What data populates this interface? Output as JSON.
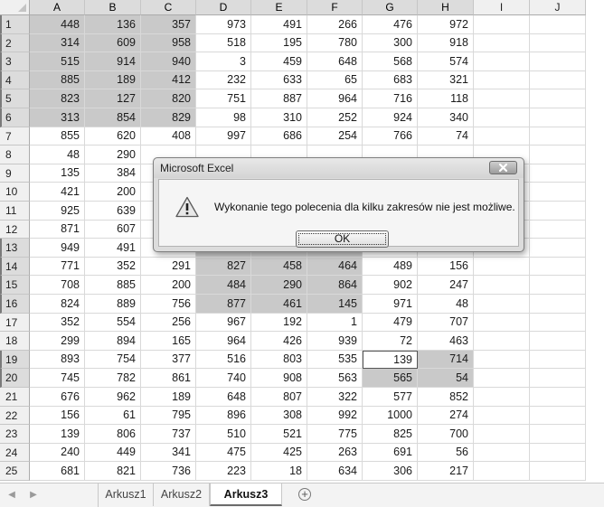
{
  "columns": [
    "A",
    "B",
    "C",
    "D",
    "E",
    "F",
    "G",
    "H",
    "I",
    "J"
  ],
  "rows": [
    {
      "num": "1",
      "cells": [
        "448",
        "136",
        "357",
        "973",
        "491",
        "266",
        "476",
        "972"
      ]
    },
    {
      "num": "2",
      "cells": [
        "314",
        "609",
        "958",
        "518",
        "195",
        "780",
        "300",
        "918"
      ]
    },
    {
      "num": "3",
      "cells": [
        "515",
        "914",
        "940",
        "3",
        "459",
        "648",
        "568",
        "574"
      ]
    },
    {
      "num": "4",
      "cells": [
        "885",
        "189",
        "412",
        "232",
        "633",
        "65",
        "683",
        "321"
      ]
    },
    {
      "num": "5",
      "cells": [
        "823",
        "127",
        "820",
        "751",
        "887",
        "964",
        "716",
        "118"
      ]
    },
    {
      "num": "6",
      "cells": [
        "313",
        "854",
        "829",
        "98",
        "310",
        "252",
        "924",
        "340"
      ]
    },
    {
      "num": "7",
      "cells": [
        "855",
        "620",
        "408",
        "997",
        "686",
        "254",
        "766",
        "74"
      ]
    },
    {
      "num": "8",
      "cells": [
        "48",
        "290",
        "",
        "",
        "",
        "",
        "",
        ""
      ]
    },
    {
      "num": "9",
      "cells": [
        "135",
        "384",
        "",
        "",
        "",
        "",
        "",
        ""
      ]
    },
    {
      "num": "10",
      "cells": [
        "421",
        "200",
        "",
        "",
        "",
        "",
        "",
        ""
      ]
    },
    {
      "num": "11",
      "cells": [
        "925",
        "639",
        "",
        "",
        "",
        "",
        "",
        ""
      ]
    },
    {
      "num": "12",
      "cells": [
        "871",
        "607",
        "",
        "",
        "",
        "",
        "",
        ""
      ]
    },
    {
      "num": "13",
      "cells": [
        "949",
        "491",
        "",
        "",
        "",
        "",
        "",
        ""
      ]
    },
    {
      "num": "14",
      "cells": [
        "771",
        "352",
        "291",
        "827",
        "458",
        "464",
        "489",
        "156"
      ]
    },
    {
      "num": "15",
      "cells": [
        "708",
        "885",
        "200",
        "484",
        "290",
        "864",
        "902",
        "247"
      ]
    },
    {
      "num": "16",
      "cells": [
        "824",
        "889",
        "756",
        "877",
        "461",
        "145",
        "971",
        "48"
      ]
    },
    {
      "num": "17",
      "cells": [
        "352",
        "554",
        "256",
        "967",
        "192",
        "1",
        "479",
        "707"
      ]
    },
    {
      "num": "18",
      "cells": [
        "299",
        "894",
        "165",
        "964",
        "426",
        "939",
        "72",
        "463"
      ]
    },
    {
      "num": "19",
      "cells": [
        "893",
        "754",
        "377",
        "516",
        "803",
        "535",
        "139",
        "714"
      ]
    },
    {
      "num": "20",
      "cells": [
        "745",
        "782",
        "861",
        "740",
        "908",
        "563",
        "565",
        "54"
      ]
    },
    {
      "num": "21",
      "cells": [
        "676",
        "962",
        "189",
        "648",
        "807",
        "322",
        "577",
        "852"
      ]
    },
    {
      "num": "22",
      "cells": [
        "156",
        "61",
        "795",
        "896",
        "308",
        "992",
        "1000",
        "274"
      ]
    },
    {
      "num": "23",
      "cells": [
        "139",
        "806",
        "737",
        "510",
        "521",
        "775",
        "825",
        "700"
      ]
    },
    {
      "num": "24",
      "cells": [
        "240",
        "449",
        "341",
        "475",
        "425",
        "263",
        "691",
        "56"
      ]
    },
    {
      "num": "25",
      "cells": [
        "681",
        "821",
        "736",
        "223",
        "18",
        "634",
        "306",
        "217"
      ]
    }
  ],
  "selected_ranges": [
    "A1:C6",
    "D13:F16",
    "G19:H20"
  ],
  "active_cell": "G19",
  "sheet_tabs": [
    {
      "label": "Arkusz1",
      "active": false
    },
    {
      "label": "Arkusz2",
      "active": false
    },
    {
      "label": "Arkusz3",
      "active": true
    }
  ],
  "dialog": {
    "title": "Microsoft Excel",
    "message": "Wykonanie tego polecenia dla kilku zakresów nie jest możliwe.",
    "ok_label": "OK",
    "icon": "warning-icon"
  },
  "colors": {
    "selection": "#c9c9c9",
    "header_bg": "#f0f0f0",
    "header_highlight": "#dcdcdc"
  }
}
